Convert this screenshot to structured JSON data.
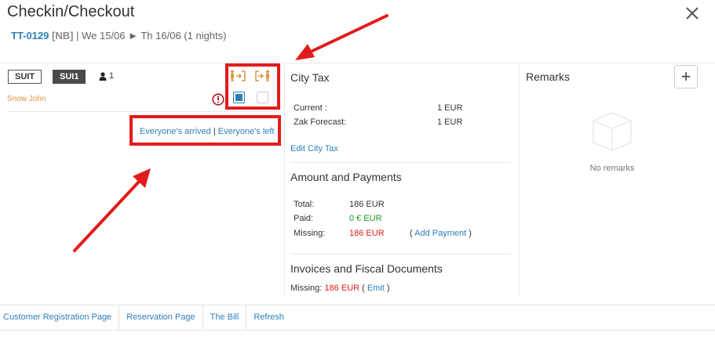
{
  "header": {
    "title": "Checkin/Checkout",
    "code": "TT-0129",
    "tag": "[NB]",
    "dates": "| We 15/06 ► Th 16/06 (1 nights)"
  },
  "room": {
    "category": "SUIT",
    "number": "SUI1",
    "guest_count": "1",
    "guest_name": "Snow John",
    "checkin_checked": true,
    "checkout_checked": false,
    "everyone_arrived": "Everyone's arrived",
    "separator": "|",
    "everyone_left": "Everyone's left"
  },
  "city_tax": {
    "title": "City Tax",
    "current_label": "Current :",
    "current_value": "1 EUR",
    "forecast_label": "Zak Forecast:",
    "forecast_value": "1 EUR",
    "edit_link": "Edit City Tax"
  },
  "payments": {
    "title": "Amount and Payments",
    "total_label": "Total:",
    "total_value": "186 EUR",
    "paid_label": "Paid:",
    "paid_value": "0 € EUR",
    "missing_label": "Missing:",
    "missing_value": "186 EUR",
    "add_payment_open": "(",
    "add_payment": "Add Payment",
    "add_payment_close": ")"
  },
  "invoices": {
    "title": "Invoices and Fiscal Documents",
    "missing_label": "Missing:",
    "missing_value": "186 EUR",
    "emit_open": "(",
    "emit": "Emit",
    "emit_close": ")"
  },
  "remarks": {
    "title": "Remarks",
    "empty_text": "No remarks",
    "add_symbol": "+"
  },
  "footer": {
    "tabs": [
      "Customer Registration Page",
      "Reservation Page",
      "The Bill",
      "Refresh"
    ]
  },
  "colors": {
    "link": "#2e7fb8",
    "highlight_red": "#e21b1b",
    "guest_orange": "#e0943a",
    "paid_green": "#1a9b1a"
  }
}
